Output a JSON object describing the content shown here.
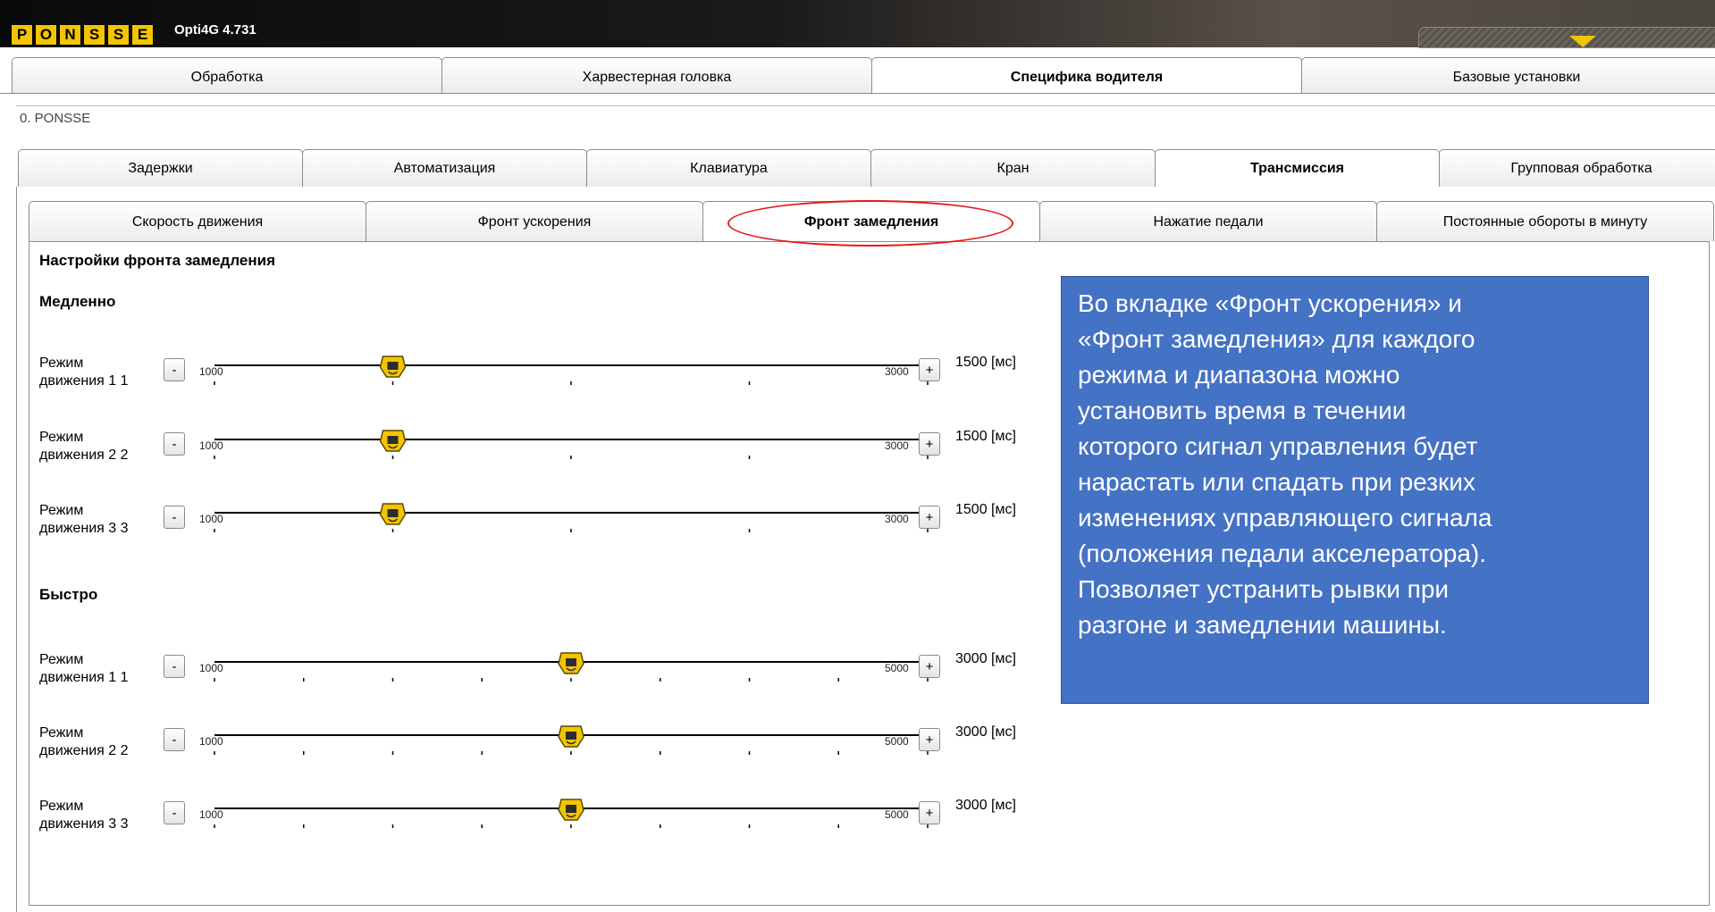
{
  "app": {
    "logo_letters": [
      "P",
      "O",
      "N",
      "S",
      "S",
      "E"
    ],
    "version": "Opti4G 4.731",
    "menu_icon": "chevron-down-icon"
  },
  "main_tabs": [
    {
      "label": "Обработка",
      "active": false
    },
    {
      "label": "Харвестерная головка",
      "active": false
    },
    {
      "label": "Специфика водителя",
      "active": true
    },
    {
      "label": "Базовые установки",
      "active": false
    }
  ],
  "operator_path": "0. PONSSE",
  "sub_tabs": [
    {
      "label": "Задержки",
      "active": false
    },
    {
      "label": "Автоматизация",
      "active": false
    },
    {
      "label": "Клавиатура",
      "active": false
    },
    {
      "label": "Кран",
      "active": false
    },
    {
      "label": "Трансмиссия",
      "active": true
    },
    {
      "label": "Групповая обработка",
      "active": false
    }
  ],
  "third_tabs": [
    {
      "label": "Скорость движения",
      "active": false
    },
    {
      "label": "Фронт ускорения",
      "active": false
    },
    {
      "label": "Фронт замедления",
      "active": true
    },
    {
      "label": "Нажатие педали",
      "active": false
    },
    {
      "label": "Постоянные обороты в минуту",
      "active": false
    }
  ],
  "highlight_color": "#e21b1b",
  "section_title": "Настройки фронта замедления",
  "groups": [
    {
      "title": "Медленно",
      "rows": [
        {
          "label_line1": "Режим",
          "label_line2": "движения 1 1",
          "min": "1000",
          "max": "3000",
          "value": 1500,
          "value_text": "1500 [мс]",
          "min_val": 1000,
          "max_val": 3000,
          "ticks": 4
        },
        {
          "label_line1": "Режим",
          "label_line2": "движения 2 2",
          "min": "1000",
          "max": "3000",
          "value": 1500,
          "value_text": "1500 [мс]",
          "min_val": 1000,
          "max_val": 3000,
          "ticks": 4
        },
        {
          "label_line1": "Режим",
          "label_line2": "движения 3 3",
          "min": "1000",
          "max": "3000",
          "value": 1500,
          "value_text": "1500 [мс]",
          "min_val": 1000,
          "max_val": 3000,
          "ticks": 4
        }
      ]
    },
    {
      "title": "Быстро",
      "rows": [
        {
          "label_line1": "Режим",
          "label_line2": "движения 1 1",
          "min": "1000",
          "max": "5000",
          "value": 3000,
          "value_text": "3000 [мс]",
          "min_val": 1000,
          "max_val": 5000,
          "ticks": 8
        },
        {
          "label_line1": "Режим",
          "label_line2": "движения 2 2",
          "min": "1000",
          "max": "5000",
          "value": 3000,
          "value_text": "3000 [мс]",
          "min_val": 1000,
          "max_val": 5000,
          "ticks": 8
        },
        {
          "label_line1": "Режим",
          "label_line2": "движения 3 3",
          "min": "1000",
          "max": "5000",
          "value": 3000,
          "value_text": "3000 [мс]",
          "min_val": 1000,
          "max_val": 5000,
          "ticks": 8
        }
      ]
    }
  ],
  "buttons": {
    "minus": "-",
    "plus": "+"
  },
  "info_box": {
    "lines": [
      " Во вкладке «Фронт ускорения» и",
      "«Фронт замедления» для каждого",
      "режима и диапазона можно",
      "установить время в течении",
      "которого сигнал управления будет",
      "нарастать или спадать при резких",
      "изменениях управляющего сигнала",
      "(положения педали акселератора).",
      "  Позволяет устранить рывки при",
      "разгоне и замедлении машины."
    ],
    "background": "#4472c4"
  },
  "colors": {
    "thumb": "#f3c400",
    "brand": "#f3c400"
  }
}
